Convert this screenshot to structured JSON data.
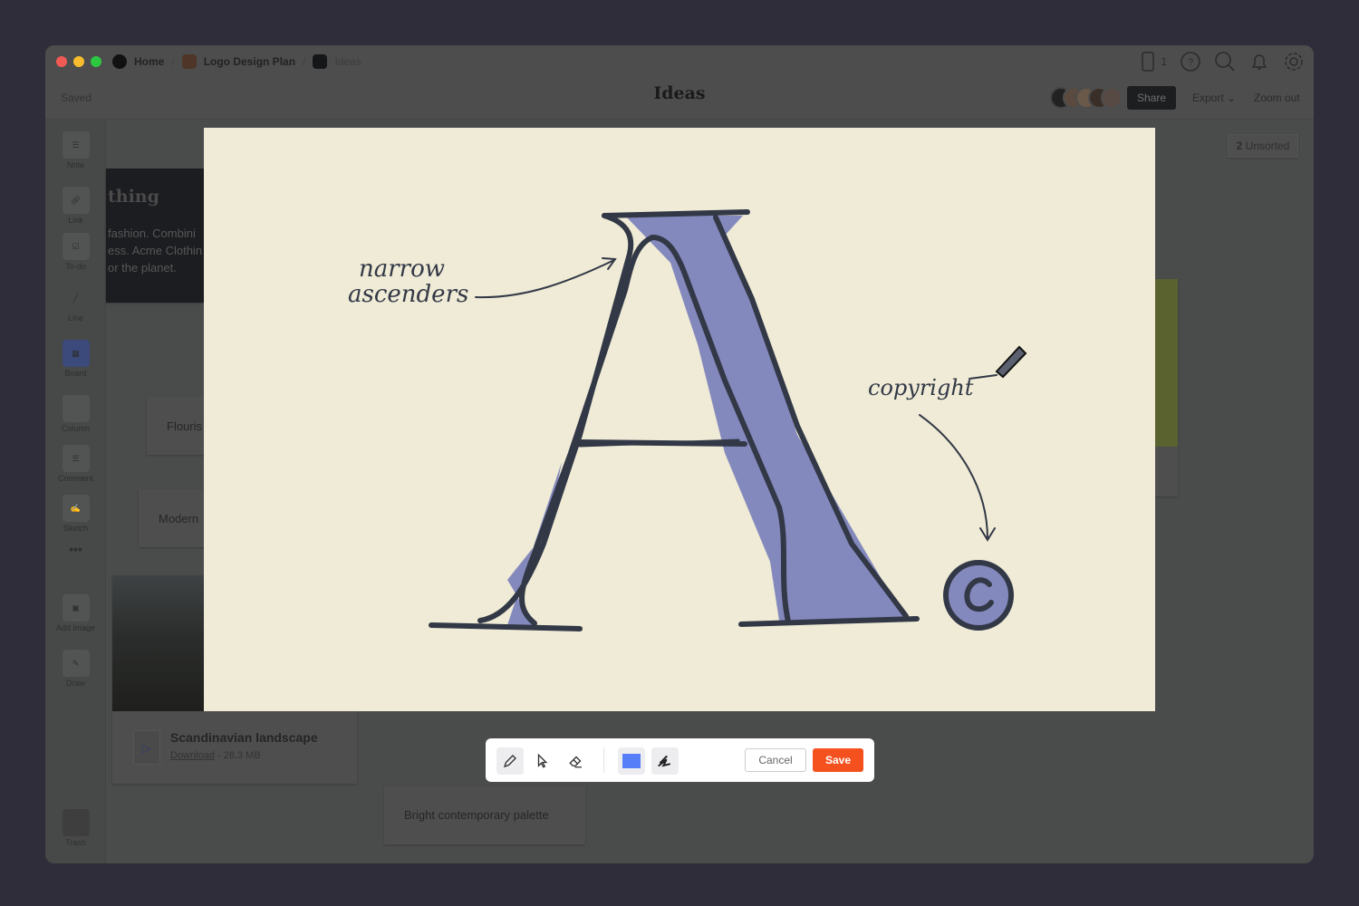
{
  "breadcrumbs": [
    {
      "label": "Home"
    },
    {
      "label": "Logo Design Plan"
    },
    {
      "label": "Ideas"
    }
  ],
  "header": {
    "saved": "Saved",
    "title": "Ideas",
    "share": "Share",
    "export": "Export",
    "zoom_out": "Zoom out",
    "device_count": "1"
  },
  "unsorted": {
    "count": "2",
    "label": "Unsorted"
  },
  "sidebar": {
    "items": [
      {
        "label": "Note"
      },
      {
        "label": "Link"
      },
      {
        "label": "To-do"
      },
      {
        "label": "Line"
      },
      {
        "label": "Board"
      },
      {
        "label": "Column"
      },
      {
        "label": "Comment"
      },
      {
        "label": "Sketch"
      },
      {
        "label": "Add image"
      },
      {
        "label": "Draw"
      }
    ],
    "trash": "Trash"
  },
  "cards": {
    "dark_title": "thing",
    "dark_body": [
      "fashion. Combini",
      "ess. Acme Clothin",
      "or the planet."
    ],
    "flourish": "Flouris",
    "modern": "Modern",
    "file_name": "Scandinavian landscape",
    "file_link": "Download",
    "file_size": " - 28.3 MB",
    "palette": "Bright contemporary palette"
  },
  "sketch": {
    "note1_line1": "narrow",
    "note1_line2": "ascenders",
    "note2": "copyright",
    "fill_color": "#8489bd",
    "stroke_color": "#323846"
  },
  "draw_toolbar": {
    "cancel": "Cancel",
    "save": "Save",
    "selected_color": "#557ef8",
    "active_tool": "pencil"
  }
}
